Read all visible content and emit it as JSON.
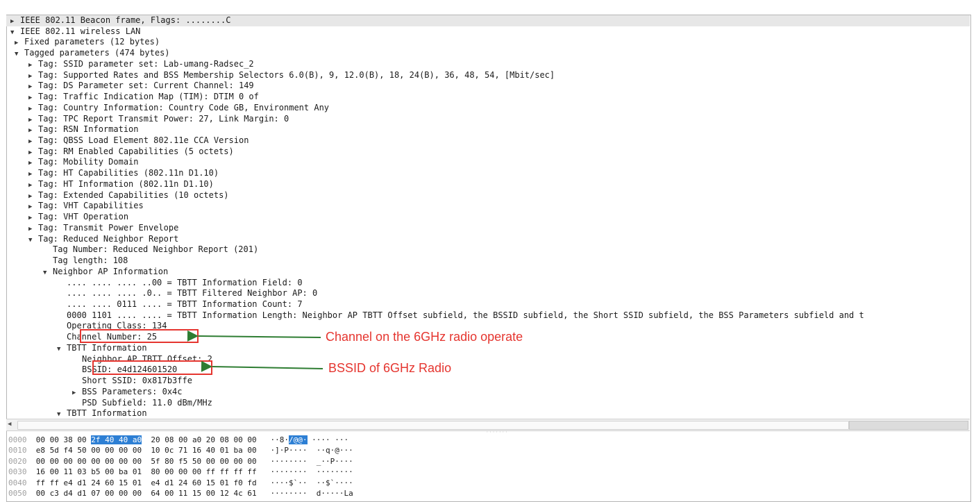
{
  "tree": [
    {
      "indent": 0,
      "arrow": "right",
      "text": "IEEE 802.11 Beacon frame, Flags: ........C"
    },
    {
      "indent": 0,
      "arrow": "down",
      "text": "IEEE 802.11 wireless LAN"
    },
    {
      "indent": 1,
      "arrow": "right",
      "text": "Fixed parameters (12 bytes)"
    },
    {
      "indent": 1,
      "arrow": "down",
      "text": "Tagged parameters (474 bytes)"
    },
    {
      "indent": 2,
      "arrow": "right",
      "text": "Tag: SSID parameter set: Lab-umang-Radsec_2"
    },
    {
      "indent": 2,
      "arrow": "right",
      "text": "Tag: Supported Rates and BSS Membership Selectors 6.0(B), 9, 12.0(B), 18, 24(B), 36, 48, 54, [Mbit/sec]"
    },
    {
      "indent": 2,
      "arrow": "right",
      "text": "Tag: DS Parameter set: Current Channel: 149"
    },
    {
      "indent": 2,
      "arrow": "right",
      "text": "Tag: Traffic Indication Map (TIM): DTIM 0 of"
    },
    {
      "indent": 2,
      "arrow": "right",
      "text": "Tag: Country Information: Country Code GB, Environment Any"
    },
    {
      "indent": 2,
      "arrow": "right",
      "text": "Tag: TPC Report Transmit Power: 27, Link Margin: 0"
    },
    {
      "indent": 2,
      "arrow": "right",
      "text": "Tag: RSN Information"
    },
    {
      "indent": 2,
      "arrow": "right",
      "text": "Tag: QBSS Load Element 802.11e CCA Version"
    },
    {
      "indent": 2,
      "arrow": "right",
      "text": "Tag: RM Enabled Capabilities (5 octets)"
    },
    {
      "indent": 2,
      "arrow": "right",
      "text": "Tag: Mobility Domain"
    },
    {
      "indent": 2,
      "arrow": "right",
      "text": "Tag: HT Capabilities (802.11n D1.10)"
    },
    {
      "indent": 2,
      "arrow": "right",
      "text": "Tag: HT Information (802.11n D1.10)"
    },
    {
      "indent": 2,
      "arrow": "right",
      "text": "Tag: Extended Capabilities (10 octets)"
    },
    {
      "indent": 2,
      "arrow": "right",
      "text": "Tag: VHT Capabilities"
    },
    {
      "indent": 2,
      "arrow": "right",
      "text": "Tag: VHT Operation"
    },
    {
      "indent": 2,
      "arrow": "right",
      "text": "Tag: Transmit Power Envelope"
    },
    {
      "indent": 2,
      "arrow": "down",
      "text": "Tag: Reduced Neighbor Report"
    },
    {
      "indent": 3,
      "arrow": "none",
      "text": "Tag Number: Reduced Neighbor Report (201)"
    },
    {
      "indent": 3,
      "arrow": "none",
      "text": "Tag length: 108"
    },
    {
      "indent": 3,
      "arrow": "down",
      "text": "Neighbor AP Information"
    },
    {
      "indent": 4,
      "arrow": "none",
      "text": ".... .... .... ..00 = TBTT Information Field: 0"
    },
    {
      "indent": 4,
      "arrow": "none",
      "text": ".... .... .... .0.. = TBTT Filtered Neighbor AP: 0"
    },
    {
      "indent": 4,
      "arrow": "none",
      "text": ".... .... 0111 .... = TBTT Information Count: 7"
    },
    {
      "indent": 4,
      "arrow": "none",
      "text": "0000 1101 .... .... = TBTT Information Length: Neighbor AP TBTT Offset subfield, the BSSID subfield, the Short SSID subfield, the BSS Parameters subfield and t"
    },
    {
      "indent": 4,
      "arrow": "none",
      "text": "Operating Class: 134"
    },
    {
      "indent": 4,
      "arrow": "none",
      "text": "Channel Number: 25"
    },
    {
      "indent": 4,
      "arrow": "down",
      "text": "TBTT Information"
    },
    {
      "indent": 5,
      "arrow": "none",
      "text": "Neighbor AP TBTT Offset: 2"
    },
    {
      "indent": 5,
      "arrow": "none",
      "text": "BSSID: e4d124601520"
    },
    {
      "indent": 5,
      "arrow": "none",
      "text": "Short SSID: 0x817b3ffe"
    },
    {
      "indent": 5,
      "arrow": "right",
      "text": "BSS Parameters: 0x4c"
    },
    {
      "indent": 5,
      "arrow": "none",
      "text": "PSD Subfield: 11.0 dBm/MHz"
    },
    {
      "indent": 4,
      "arrow": "down",
      "text": "TBTT Information"
    }
  ],
  "hex_rows": [
    {
      "offset": "0000",
      "pre": "00 00 38 00 ",
      "hl": "2f 40 40 a0",
      "post": "  20 08 00 a0 20 08 00 00",
      "ascii_pre": "··8·",
      "ascii_hl": "/@@·",
      "ascii_post": " ···· ···"
    },
    {
      "offset": "0010",
      "pre": "e8 5d f4 50 00 00 00 00  10 0c 71 16 40 01 ba 00",
      "hl": "",
      "post": "",
      "ascii_pre": "·]·P····  ··q·@···",
      "ascii_hl": "",
      "ascii_post": ""
    },
    {
      "offset": "0020",
      "pre": "00 00 00 00 00 00 00 00  5f 80 f5 50 00 00 00 00",
      "hl": "",
      "post": "",
      "ascii_pre": "········  _··P····",
      "ascii_hl": "",
      "ascii_post": ""
    },
    {
      "offset": "0030",
      "pre": "16 00 11 03 b5 00 ba 01  80 00 00 00 ff ff ff ff",
      "hl": "",
      "post": "",
      "ascii_pre": "········  ········",
      "ascii_hl": "",
      "ascii_post": ""
    },
    {
      "offset": "0040",
      "pre": "ff ff e4 d1 24 60 15 01  e4 d1 24 60 15 01 f0 fd",
      "hl": "",
      "post": "",
      "ascii_pre": "····$`··  ··$`····",
      "ascii_hl": "",
      "ascii_post": ""
    },
    {
      "offset": "0050",
      "pre": "00 c3 d4 d1 07 00 00 00  64 00 11 15 00 12 4c 61",
      "hl": "",
      "post": "",
      "ascii_pre": "········  d·····La",
      "ascii_hl": "",
      "ascii_post": ""
    }
  ],
  "annotations": {
    "channel_note": "Channel on the 6GHz radio operate",
    "bssid_note": "BSSID of 6GHz Radio"
  },
  "icons": {
    "expand": "triangle-right-icon",
    "collapse": "triangle-down-icon"
  },
  "colors": {
    "annotation": "#e5352f",
    "arrow": "#2e7d32",
    "hex_highlight": "#2d7fd4"
  }
}
